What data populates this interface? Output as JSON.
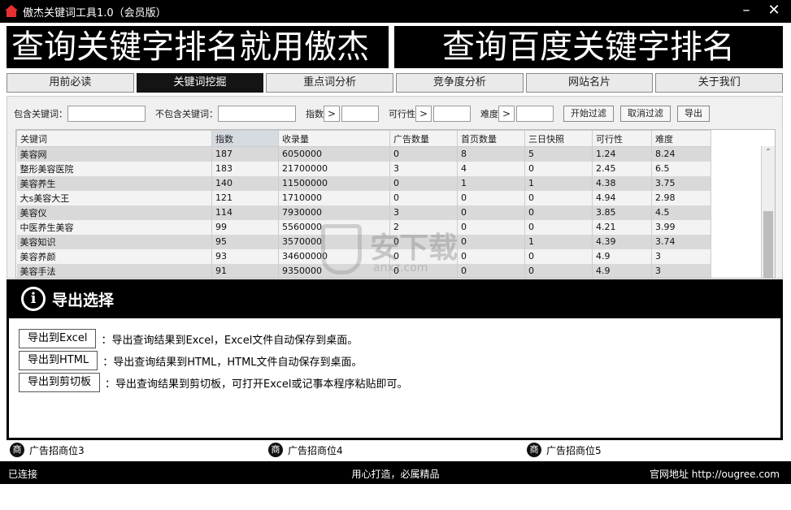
{
  "window": {
    "title": "傲杰关键词工具1.0（会员版）",
    "minimize_glyph": "–",
    "close_glyph": "✕"
  },
  "banners": {
    "left": "查询关键字排名就用傲杰",
    "right": "查询百度关键字排名"
  },
  "tabs": [
    {
      "label": "用前必读"
    },
    {
      "label": "关键词挖掘"
    },
    {
      "label": "重点词分析"
    },
    {
      "label": "竞争度分析"
    },
    {
      "label": "网站名片"
    },
    {
      "label": "关于我们"
    }
  ],
  "filter": {
    "include_label": "包含关键词：",
    "include_value": "",
    "exclude_label": "不包含关键词：",
    "exclude_value": "",
    "index_label": "指数",
    "index_op": ">",
    "index_value": "",
    "feasibility_label": "可行性",
    "feasibility_op": ">",
    "feasibility_value": "",
    "difficulty_label": "难度",
    "difficulty_op": ">",
    "difficulty_value": "",
    "start_button": "开始过滤",
    "cancel_button": "取消过滤",
    "export_button": "导出"
  },
  "table": {
    "columns": [
      "关键词",
      "指数",
      "收录量",
      "广告数量",
      "首页数量",
      "三日快照",
      "可行性",
      "难度"
    ],
    "rows": [
      [
        "美容网",
        "187",
        "6050000",
        "0",
        "8",
        "5",
        "1.24",
        "8.24"
      ],
      [
        "整形美容医院",
        "183",
        "21700000",
        "3",
        "4",
        "0",
        "2.45",
        "6.5"
      ],
      [
        "美容养生",
        "140",
        "11500000",
        "0",
        "1",
        "1",
        "4.38",
        "3.75"
      ],
      [
        "大s美容大王",
        "121",
        "1710000",
        "0",
        "0",
        "0",
        "4.94",
        "2.98"
      ],
      [
        "美容仪",
        "114",
        "7930000",
        "3",
        "0",
        "0",
        "3.85",
        "4.5"
      ],
      [
        "中医养生美容",
        "99",
        "5560000",
        "2",
        "0",
        "0",
        "4.21",
        "3.99"
      ],
      [
        "美容知识",
        "95",
        "3570000",
        "0",
        "0",
        "1",
        "4.39",
        "3.74"
      ],
      [
        "美容养颜",
        "93",
        "34600000",
        "0",
        "0",
        "0",
        "4.9",
        "3"
      ],
      [
        "美容手法",
        "91",
        "9350000",
        "0",
        "0",
        "0",
        "4.9",
        "3"
      ]
    ],
    "scroll_up_glyph": "⌃"
  },
  "watermark": {
    "text": "安下载",
    "sub": "anxz.com"
  },
  "dialog": {
    "icon": "i",
    "title": "导出选择",
    "options": [
      {
        "button": "导出到Excel",
        "desc": "：导出查询结果到Excel，Excel文件自动保存到桌面。"
      },
      {
        "button": "导出到HTML",
        "desc": "：导出查询结果到HTML，HTML文件自动保存到桌面。"
      },
      {
        "button": "导出到剪切板",
        "desc": "：导出查询结果到剪切板，可打开Excel或记事本程序粘贴即可。"
      }
    ]
  },
  "ads": [
    {
      "icon": "商",
      "label": "广告招商位3"
    },
    {
      "icon": "商",
      "label": "广告招商位4"
    },
    {
      "icon": "商",
      "label": "广告招商位5"
    }
  ],
  "status": {
    "connection": "已连接",
    "slogan": "用心打造，必属精品",
    "site": "官网地址  http://ougree.com"
  },
  "colors": {
    "brand_red": "#e53030",
    "chrome_black": "#000000",
    "row_odd": "#d9d9d9",
    "row_even": "#f3f3f3"
  }
}
